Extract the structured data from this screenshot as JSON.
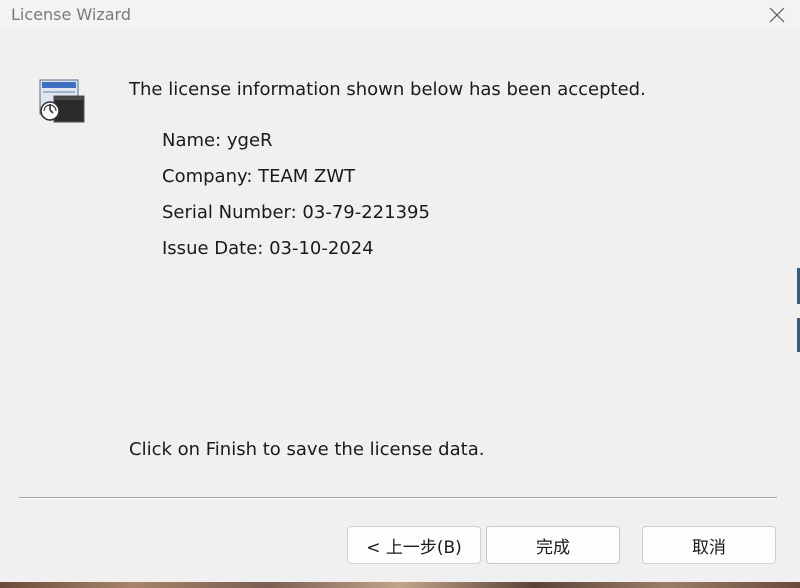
{
  "window": {
    "title": "License Wizard"
  },
  "icons": {
    "app": "license-wizard-icon",
    "close": "close-icon"
  },
  "content": {
    "intro": "The license information shown below has been accepted.",
    "info": [
      {
        "label": "Name: ygeR"
      },
      {
        "label": "Company: TEAM ZWT"
      },
      {
        "label": "Serial Number: 03-79-221395"
      },
      {
        "label": "Issue Date: 03-10-2024"
      }
    ],
    "outro": "Click on Finish to save the license data."
  },
  "buttons": {
    "back": "< 上一步(B)",
    "finish": "完成",
    "cancel": "取消"
  }
}
